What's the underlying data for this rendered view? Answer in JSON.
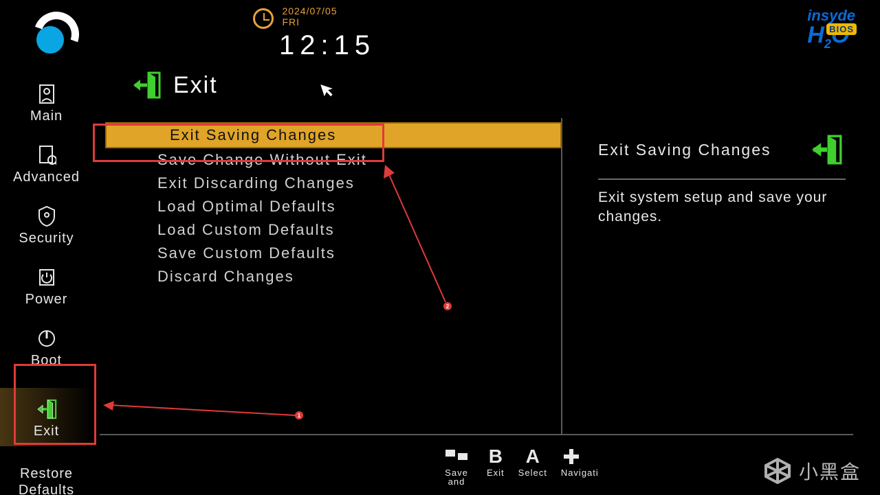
{
  "header": {
    "date": "2024/07/05",
    "day": "FRI",
    "time": "12:15"
  },
  "brand": {
    "line1": "insyde",
    "line2_a": "H",
    "line2_b": "2",
    "line2_c": "O",
    "badge": "BIOS"
  },
  "page": {
    "title": "Exit"
  },
  "sidebar": {
    "items": [
      {
        "label": "Main"
      },
      {
        "label": "Advanced"
      },
      {
        "label": "Security"
      },
      {
        "label": "Power"
      },
      {
        "label": "Boot"
      },
      {
        "label": "Exit"
      }
    ],
    "restore_line1": "Restore",
    "restore_line2": "Defaults"
  },
  "menu": {
    "items": [
      {
        "label": "Exit Saving Changes",
        "selected": true
      },
      {
        "label": "Save Change Without Exit"
      },
      {
        "label": "Exit Discarding Changes"
      },
      {
        "label": "Load Optimal Defaults"
      },
      {
        "label": "Load Custom Defaults"
      },
      {
        "label": "Save Custom Defaults"
      },
      {
        "label": "Discard Changes"
      }
    ]
  },
  "help": {
    "title": "Exit Saving Changes",
    "body": "Exit system setup and save your changes."
  },
  "hints": [
    {
      "label": "Save and"
    },
    {
      "label": "Exit"
    },
    {
      "label": "Select"
    },
    {
      "label": "Navigati"
    }
  ],
  "watermark": "小黑盒"
}
